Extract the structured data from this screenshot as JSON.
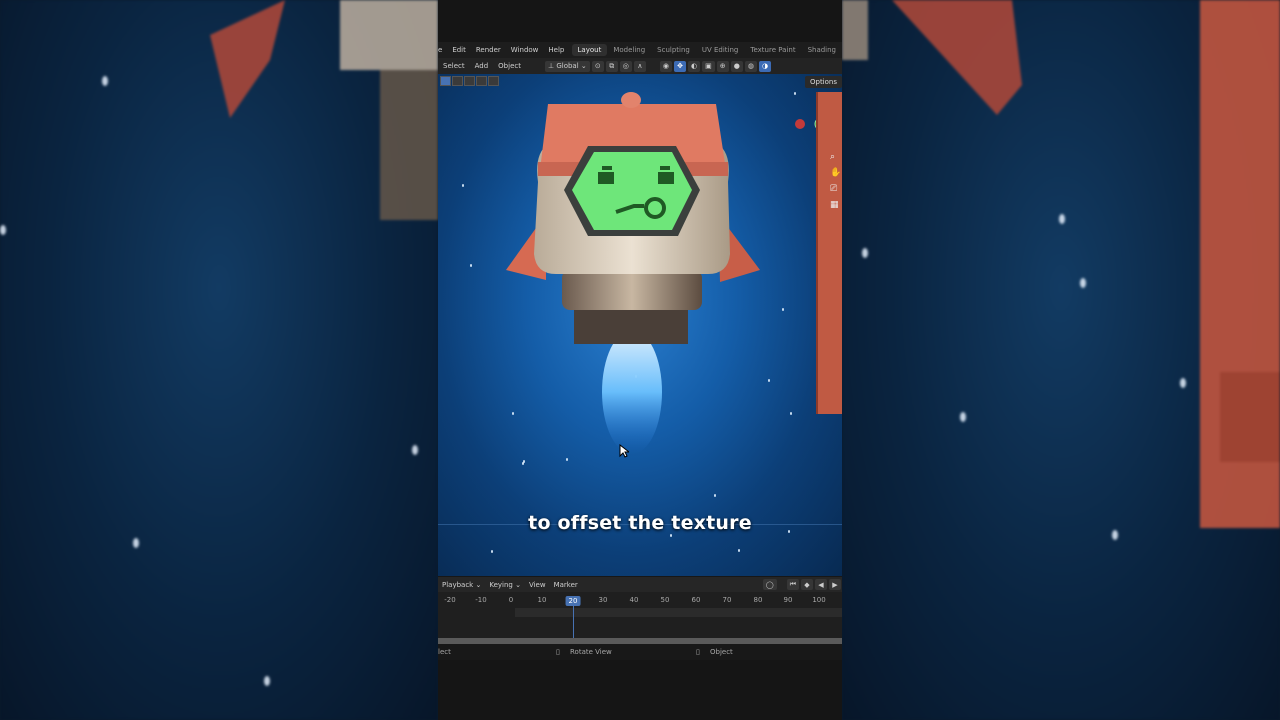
{
  "menu": {
    "items": [
      "e",
      "Edit",
      "Render",
      "Window",
      "Help"
    ],
    "workspaces": [
      "Layout",
      "Modeling",
      "Sculpting",
      "UV Editing",
      "Texture Paint",
      "Shading"
    ],
    "active_workspace": "Layout"
  },
  "toolbar": {
    "select": "Select",
    "add": "Add",
    "object": "Object",
    "transform_orientation": "Global"
  },
  "viewport": {
    "options_label": "Options",
    "subtitle": "to offset the texture",
    "background_color": "#145da8"
  },
  "timeline": {
    "menus": [
      "Playback",
      "Keying",
      "View",
      "Marker"
    ],
    "ticks": [
      "-20",
      "-10",
      "0",
      "10",
      "30",
      "40",
      "50",
      "60",
      "70",
      "80",
      "90",
      "100"
    ],
    "current_frame": "20"
  },
  "status": {
    "left": "lect",
    "middle": "Rotate View",
    "right": "Object"
  },
  "colors": {
    "accent": "#4772b3",
    "rocket_body": "#e07a62",
    "screen_green": "#5fe06a"
  }
}
